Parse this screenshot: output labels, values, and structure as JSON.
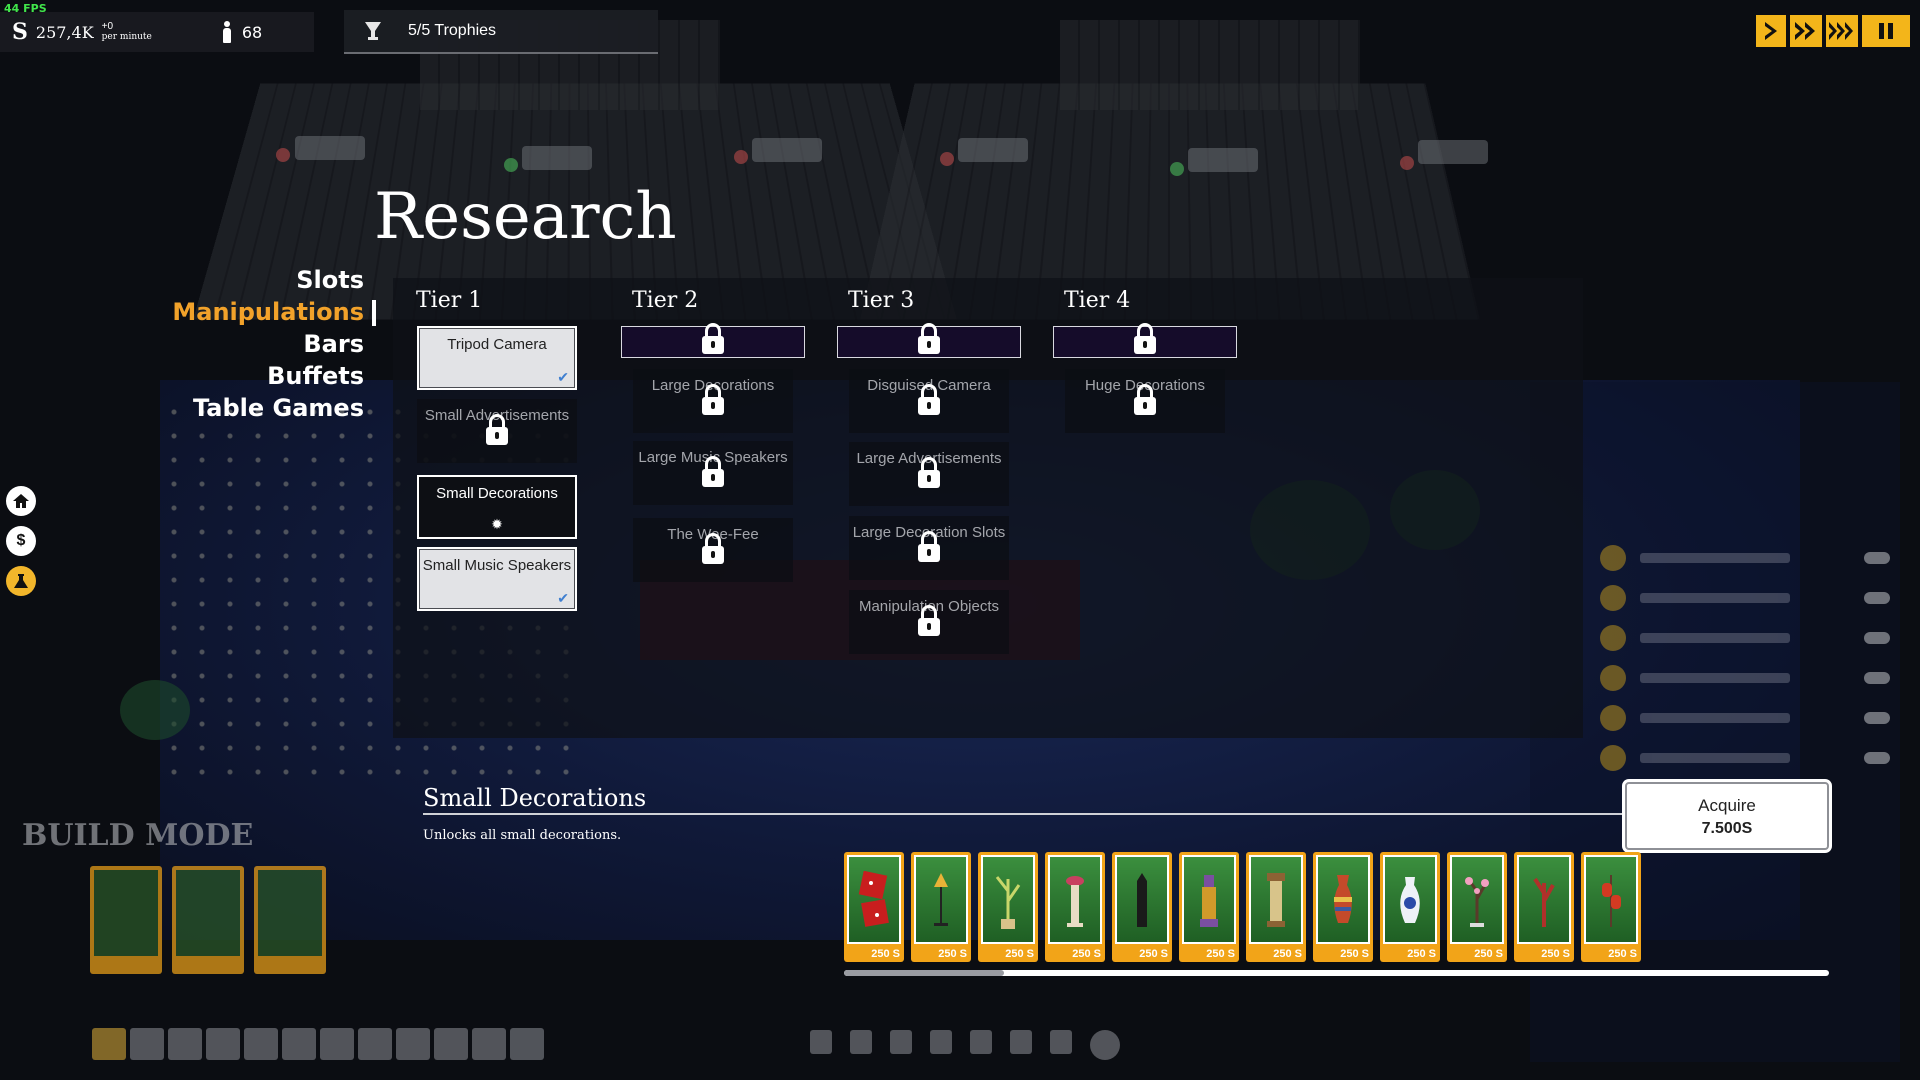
{
  "hud": {
    "fps": "44 FPS",
    "money_symbol": "S",
    "money": "257,4K",
    "money_rate": "+0",
    "money_rate_unit": "per minute",
    "visitors": "68",
    "trophies": "5/5 Trophies"
  },
  "speed_controls": [
    "play",
    "fast",
    "fastest",
    "pause"
  ],
  "research": {
    "title": "Research",
    "categories": [
      "Slots",
      "Manipulations",
      "Bars",
      "Buffets",
      "Table Games"
    ],
    "active_category": "Manipulations",
    "tiers": [
      {
        "label": "Tier 1",
        "nodes": [
          {
            "label": "Tripod Camera",
            "state": "owned"
          },
          {
            "label": "Small Advertisements",
            "state": "locked"
          },
          {
            "label": "Small Decorations",
            "state": "selected"
          },
          {
            "label": "Small Music Speakers",
            "state": "owned"
          }
        ]
      },
      {
        "label": "Tier 2",
        "nodes": [
          {
            "label": "Large Decorations",
            "state": "locked"
          },
          {
            "label": "Large Music Speakers",
            "state": "locked"
          },
          {
            "label": "The Wee-Fee",
            "state": "locked"
          }
        ]
      },
      {
        "label": "Tier 3",
        "nodes": [
          {
            "label": "Disguised Camera",
            "state": "locked"
          },
          {
            "label": "Large Advertisements",
            "state": "locked"
          },
          {
            "label": "Large Decoration Slots",
            "state": "locked"
          },
          {
            "label": "Manipulation Objects",
            "state": "locked"
          }
        ]
      },
      {
        "label": "Tier 4",
        "nodes": [
          {
            "label": "Huge Decorations",
            "state": "locked"
          }
        ]
      }
    ],
    "detail": {
      "title": "Small Decorations",
      "description": "Unlocks all small decorations.",
      "acquire_label": "Acquire",
      "acquire_cost": "7.500S"
    },
    "unlock_items": [
      {
        "icon": "dice-decoration-icon",
        "price": "250 S"
      },
      {
        "icon": "floor-lamp-icon",
        "price": "250 S"
      },
      {
        "icon": "bamboo-plant-icon",
        "price": "250 S"
      },
      {
        "icon": "flower-pedestal-icon",
        "price": "250 S"
      },
      {
        "icon": "obelisk-icon",
        "price": "250 S"
      },
      {
        "icon": "egyptian-statue-icon",
        "price": "250 S"
      },
      {
        "icon": "column-icon",
        "price": "250 S"
      },
      {
        "icon": "striped-vase-icon",
        "price": "250 S"
      },
      {
        "icon": "porcelain-vase-icon",
        "price": "250 S"
      },
      {
        "icon": "blossom-tree-icon",
        "price": "250 S"
      },
      {
        "icon": "red-tree-icon",
        "price": "250 S"
      },
      {
        "icon": "red-lantern-icon",
        "price": "250 S"
      }
    ]
  },
  "colors": {
    "accent": "#f2a22a",
    "item_card": "#f2a418",
    "tier_bar": "#150c2a"
  }
}
